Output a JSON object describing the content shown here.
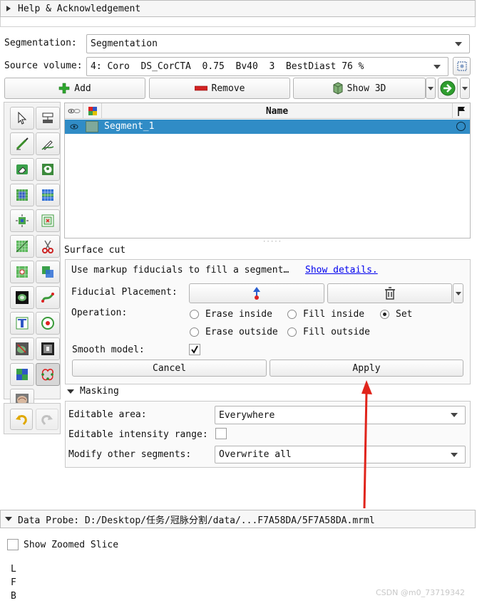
{
  "help_section": {
    "title": "Help & Acknowledgement"
  },
  "segmentation": {
    "label": "Segmentation:",
    "value": "Segmentation"
  },
  "source_volume": {
    "label": "Source volume:",
    "value": "4: Coro  DS_CorCTA  0.75  Bv40  3  BestDiast 76 %"
  },
  "toolbar": {
    "add_label": "Add",
    "remove_label": "Remove",
    "show3d_label": "Show 3D"
  },
  "table": {
    "name_header": "Name",
    "rows": [
      {
        "name": "Segment_1",
        "color": "#7fa99b"
      }
    ]
  },
  "effect": {
    "title": "Surface cut",
    "description": "Use markup fiducials to fill a segment…",
    "details_link": "Show details.",
    "fiducial_label": "Fiducial Placement:",
    "operation_label": "Operation:",
    "options": {
      "erase_inside": "Erase inside",
      "fill_inside": "Fill inside",
      "set": "Set",
      "erase_outside": "Erase outside",
      "fill_outside": "Fill outside"
    },
    "selected_option": "Set",
    "smooth_label": "Smooth model:",
    "smooth_checked": true,
    "cancel_label": "Cancel",
    "apply_label": "Apply"
  },
  "masking": {
    "title": "Masking",
    "editable_area_label": "Editable area:",
    "editable_area_value": "Everywhere",
    "intensity_label": "Editable intensity range:",
    "modify_label": "Modify other segments:",
    "modify_value": "Overwrite all"
  },
  "data_probe": {
    "title": "Data Probe: D:/Desktop/任务/冠脉分割/data/...F7A58DA/5F7A58DA.mrml",
    "zoom_label": "Show Zoomed Slice",
    "coords": [
      "L",
      "F",
      "B"
    ]
  },
  "watermark": "CSDN @m0_73719342",
  "colors": {
    "selection": "#308cc6",
    "annotation_arrow": "#e0241b",
    "link": "#0000ee"
  }
}
